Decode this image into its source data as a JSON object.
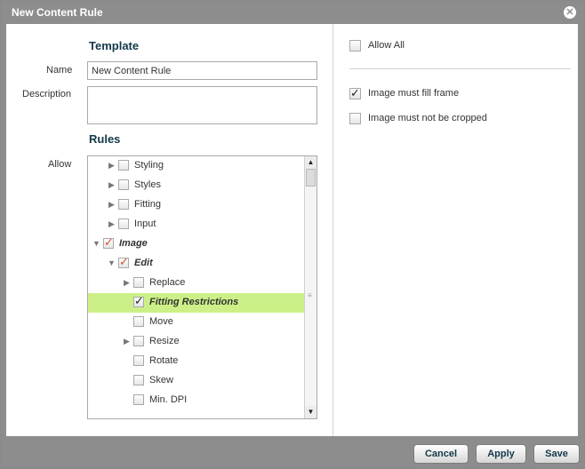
{
  "dialog": {
    "title": "New Content Rule",
    "close_icon": "close-icon"
  },
  "template": {
    "heading": "Template",
    "name_label": "Name",
    "name_value": "New Content Rule",
    "description_label": "Description",
    "description_value": ""
  },
  "rules": {
    "heading": "Rules",
    "allow_label": "Allow",
    "tree": [
      {
        "label": "Styling",
        "expandable": true,
        "expanded": false,
        "checked": false
      },
      {
        "label": "Styles",
        "expandable": true,
        "expanded": false,
        "checked": false
      },
      {
        "label": "Fitting",
        "expandable": true,
        "expanded": false,
        "checked": false
      },
      {
        "label": "Input",
        "expandable": true,
        "expanded": false,
        "checked": false
      },
      {
        "label": "Image",
        "expandable": true,
        "expanded": true,
        "checked": true,
        "check_color": "#d9542f"
      },
      {
        "label": "Edit",
        "expandable": true,
        "expanded": true,
        "checked": true,
        "check_color": "#d9542f"
      },
      {
        "label": "Replace",
        "expandable": true,
        "expanded": false,
        "checked": false
      },
      {
        "label": "Fitting Restrictions",
        "expandable": false,
        "checked": true,
        "selected": true,
        "check_color": "#222222"
      },
      {
        "label": "Move",
        "expandable": false,
        "checked": false
      },
      {
        "label": "Resize",
        "expandable": true,
        "expanded": false,
        "checked": false
      },
      {
        "label": "Rotate",
        "expandable": false,
        "checked": false
      },
      {
        "label": "Skew",
        "expandable": false,
        "checked": false
      },
      {
        "label": "Min. DPI",
        "expandable": false,
        "checked": false
      }
    ]
  },
  "options": {
    "allow_all": {
      "label": "Allow All",
      "checked": false
    },
    "fill_frame": {
      "label": "Image must fill frame",
      "checked": true
    },
    "not_cropped": {
      "label": "Image must not be cropped",
      "checked": false
    }
  },
  "buttons": {
    "cancel": "Cancel",
    "apply": "Apply",
    "save": "Save"
  },
  "colors": {
    "selection": "#ccf087",
    "heading": "#13384a",
    "frame": "#8d8d8d"
  }
}
